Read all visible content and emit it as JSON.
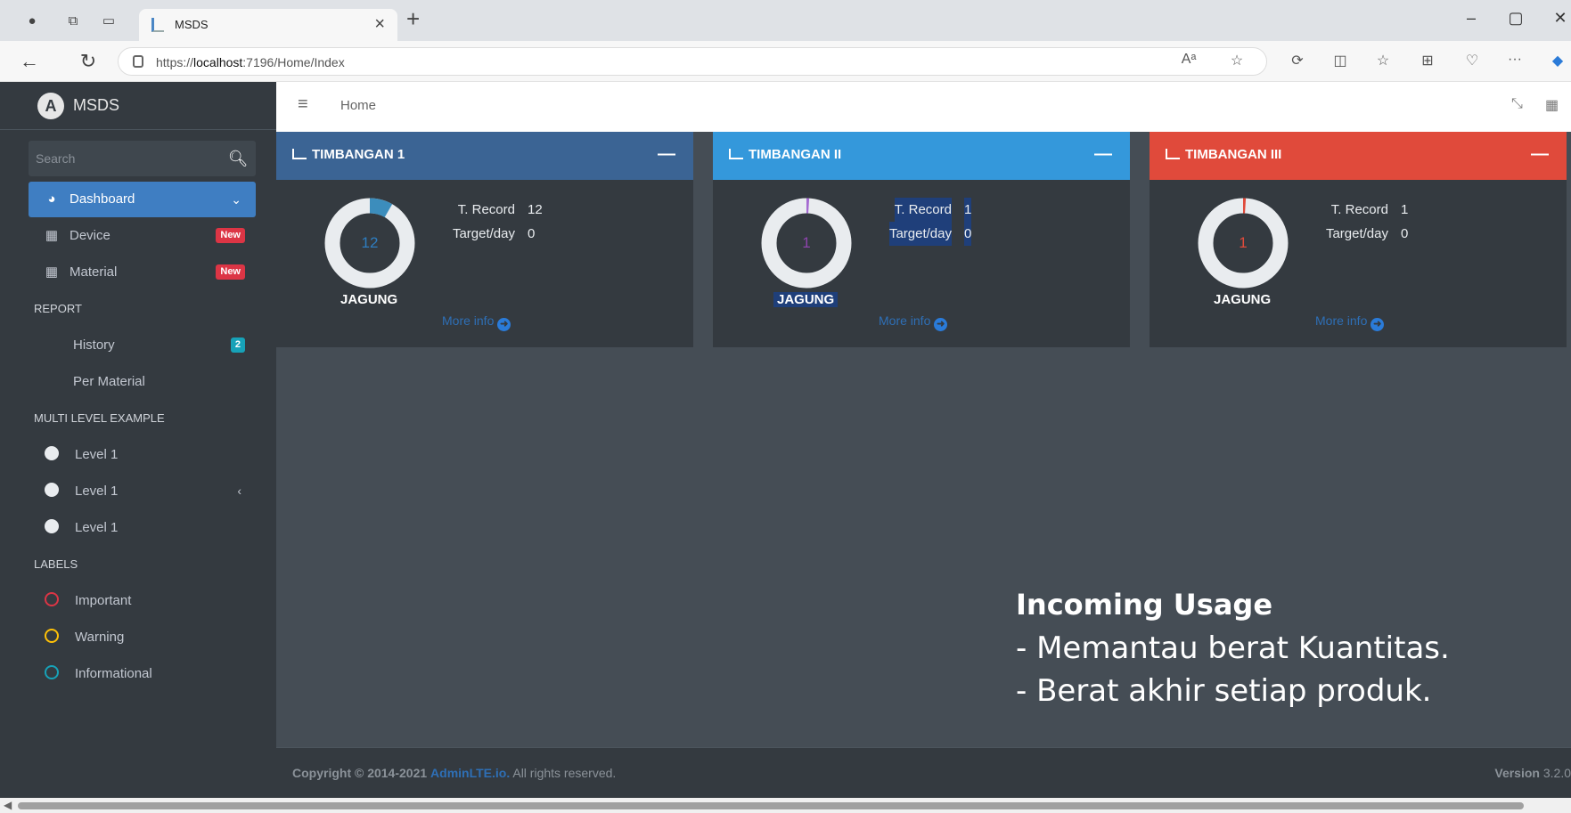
{
  "browser": {
    "tab_title": "MSDS",
    "tab_close": "×",
    "new_tab": "+",
    "url_prefix": "https://",
    "url_host": "localhost",
    "url_rest": ":7196/Home/Index",
    "toolbar_icons": [
      "read-aloud-icon",
      "favorite-star-icon",
      "extensions-icon",
      "split-screen-icon",
      "favorites-icon",
      "collections-icon",
      "performance-icon",
      "more-icon",
      "copilot-icon"
    ],
    "more_label": "···"
  },
  "sidebar": {
    "brand": "MSDS",
    "brand_logo": "A",
    "search_placeholder": "Search",
    "items": [
      {
        "label": "Dashboard",
        "icon": "dashboard-icon",
        "active": true
      },
      {
        "label": "Device",
        "icon": "grid-icon",
        "badge": "New"
      },
      {
        "label": "Material",
        "icon": "grid-icon",
        "badge": "New"
      }
    ],
    "report_header": "REPORT",
    "report_items": [
      {
        "label": "History",
        "badge": "2"
      },
      {
        "label": "Per Material"
      }
    ],
    "multi_header": "MULTI LEVEL EXAMPLE",
    "multi_items": [
      "Level 1",
      "Level 1",
      "Level 1"
    ],
    "labels_header": "LABELS",
    "label_items": [
      {
        "label": "Important",
        "color": "#dc3545"
      },
      {
        "label": "Warning",
        "color": "#ffc107"
      },
      {
        "label": "Informational",
        "color": "#17a2b8"
      }
    ]
  },
  "topnav": {
    "home": "Home"
  },
  "cards": [
    {
      "title": "TIMBANGAN 1",
      "header_color": "#3b6494",
      "value": "12",
      "value_color": "#2e7dc0",
      "fraction": 0.083,
      "arc_color": "#3c8dbc",
      "product": "JAGUNG",
      "record_label": "T. Record",
      "record_value": "12",
      "target_label": "Target/day",
      "target_value": "0",
      "more": "More info"
    },
    {
      "title": "TIMBANGAN II",
      "header_color": "#3498db",
      "value": "1",
      "value_color": "#8e44ad",
      "fraction": 0.01,
      "arc_color": "#a56bd1",
      "product": "JAGUNG",
      "record_label": "T. Record",
      "record_value": "1",
      "target_label": "Target/day",
      "target_value": "0",
      "more": "More info"
    },
    {
      "title": "TIMBANGAN III",
      "header_color": "#e04a3b",
      "value": "1",
      "value_color": "#e04a3b",
      "fraction": 0.01,
      "arc_color": "#e04a3b",
      "product": "JAGUNG",
      "record_label": "T. Record",
      "record_value": "1",
      "target_label": "Target/day",
      "target_value": "0",
      "more": "More info"
    }
  ],
  "overlay": {
    "heading": "Incoming Usage",
    "line1": "- Memantau berat Kuantitas.",
    "line2": "- Berat akhir setiap produk."
  },
  "footer": {
    "copyright": "Copyright © 2014-2021",
    "link": "AdminLTE.io.",
    "rights": "All rights reserved.",
    "version_label": "Version",
    "version": "3.2.0"
  }
}
